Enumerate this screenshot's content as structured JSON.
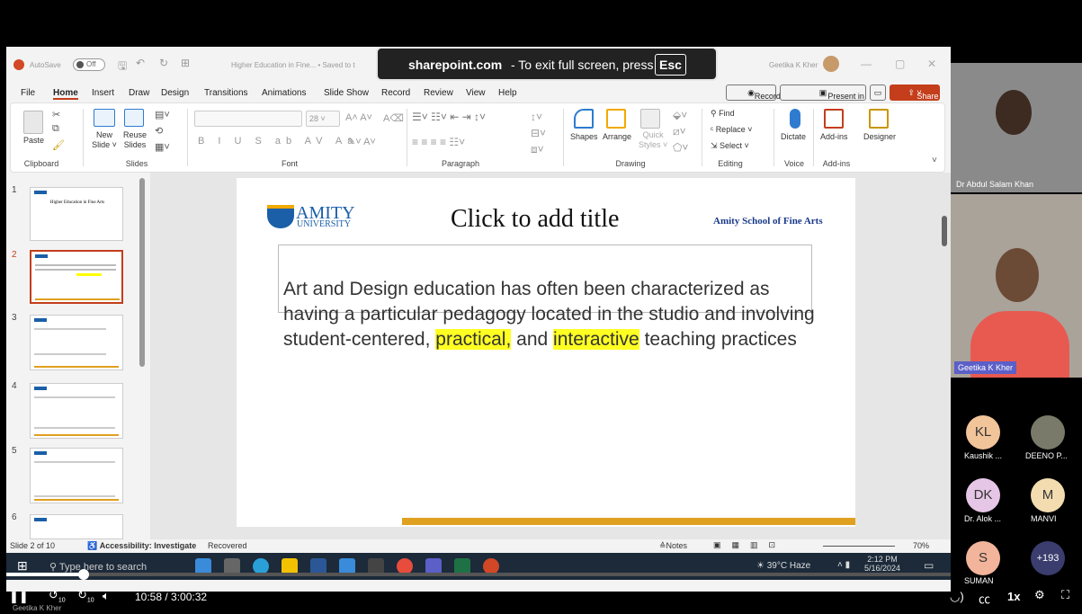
{
  "pp": {
    "autosave": "AutoSave",
    "off": "Off",
    "doc_title": "Higher Education in Fine... • Saved to t",
    "user": "Geetika K Kher"
  },
  "menu": [
    "File",
    "Home",
    "Insert",
    "Draw",
    "Design",
    "Transitions",
    "Animations",
    "Slide Show",
    "Record",
    "Review",
    "View",
    "Help"
  ],
  "record_btn": "Record",
  "present_btn": "Present in Teams",
  "share_btn": "Share",
  "ribbon": {
    "paste": "Paste",
    "new_slide": "New\nSlide ˅",
    "reuse": "Reuse\nSlides",
    "font_size": "28",
    "shapes": "Shapes",
    "arrange": "Arrange",
    "quick": "Quick\nStyles ˅",
    "find": "Find",
    "replace": "Replace",
    "select": "Select ˅",
    "dictate": "Dictate",
    "addins": "Add-ins",
    "designer": "Designer"
  },
  "groups": {
    "clipboard": "Clipboard",
    "slides": "Slides",
    "font": "Font",
    "paragraph": "Paragraph",
    "drawing": "Drawing",
    "editing": "Editing",
    "voice": "Voice",
    "addins": "Add-ins"
  },
  "thumbs": [
    "1",
    "2",
    "3",
    "4",
    "5",
    "6"
  ],
  "thumb1_title": "Higher Education in Fine Arts",
  "slide": {
    "logo_top": "AMITY",
    "logo_bottom": "UNIVERSITY",
    "title": "Click to add title",
    "school": "Amity School of Fine Arts",
    "body1": "Art and Design education has often been characterized as having a particular pedagogy located in the studio and involving student-centered, ",
    "hl1": "practical,",
    "mid": " and ",
    "hl2": "interactive",
    "body2": " teaching practices"
  },
  "status": {
    "slide_of": "Slide 2 of 10",
    "access": "Accessibility: Investigate",
    "recovered": "Recovered",
    "notes": "Notes",
    "zoom": "70%"
  },
  "taskbar": {
    "search": "Type here to search",
    "weather": "39°C Haze",
    "time": "2:12 PM",
    "date": "5/16/2024"
  },
  "toast": {
    "site": "sharepoint.com",
    "rest": " - To exit full screen, press ",
    "key": "Esc"
  },
  "participants": {
    "p1": "Dr Abdul Salam Khan",
    "p2": "Geetika K Kher",
    "kl": "KL",
    "kl_name": "Kaushik ...",
    "deeno": "DEENO P...",
    "dk": "DK",
    "dk_name": "Dr. Alok ...",
    "m": "M",
    "m_name": "MANVI",
    "s": "S",
    "s_name": "SUMAN",
    "more": "+193"
  },
  "player": {
    "time": "10:58 / 3:00:32",
    "speed": "1x",
    "speaker": "Geetika K Kher",
    "skip": "10"
  }
}
